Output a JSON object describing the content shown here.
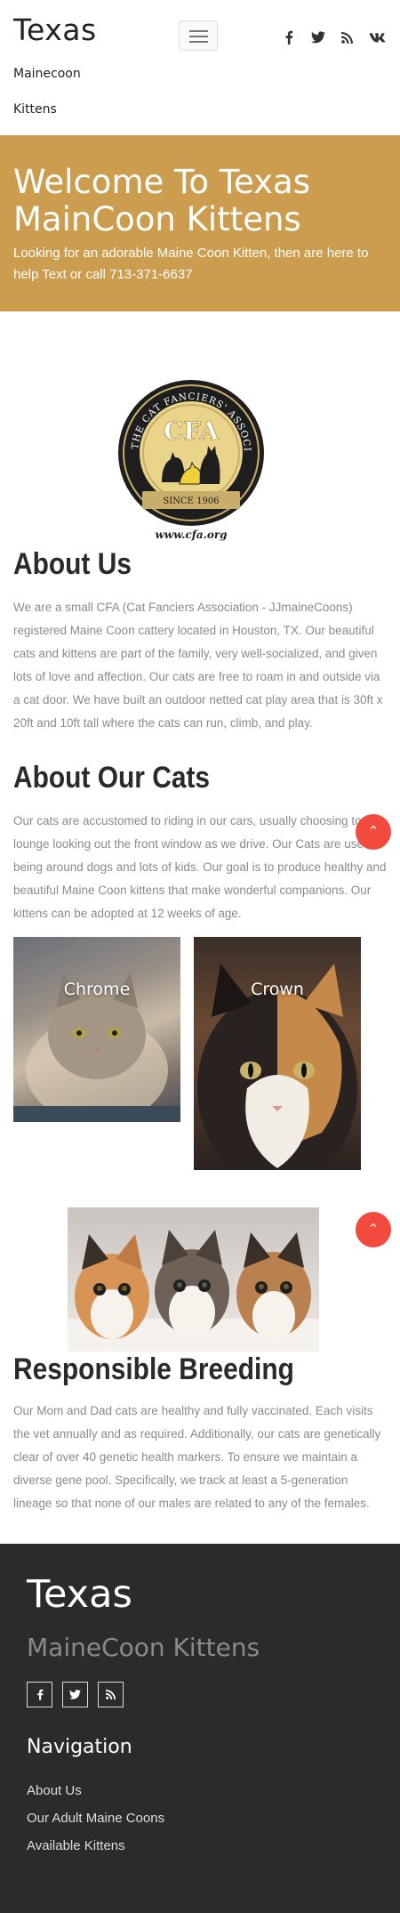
{
  "header": {
    "brand": "Texas",
    "nav": [
      "Mainecoon",
      "Kittens"
    ],
    "social_icons": [
      "facebook-icon",
      "twitter-icon",
      "rss-icon",
      "vk-icon"
    ]
  },
  "hero": {
    "title": "Welcome To Texas MainCoon Kittens",
    "subtitle": "Looking for an adorable Maine Coon Kitten, then are here to help Text or call 713-371-6637",
    "background_color": "#cc9d4e"
  },
  "cfa_logo": {
    "initials": "CFA",
    "ring_text": "THE CAT FANCIERS' ASSOCIATION",
    "since": "SINCE 1906",
    "url": "www.cfa.org"
  },
  "about_us": {
    "heading": "About Us",
    "body": "We are a small CFA (Cat Fanciers Association - JJmaineCoons) registered Maine Coon cattery located in Houston, TX. Our beautiful cats and kittens are part of the family, very well-socialized, and given lots of love and affection. Our cats are free to roam in and outside via a cat door. We have built an outdoor netted cat play area that is 30ft x 20ft and 10ft tall where the cats can run, climb, and play."
  },
  "about_cats": {
    "heading": "About Our Cats",
    "body": "Our cats are accustomed to riding in our cars, usually choosing to lounge looking out the front window as we drive. Our Cats are used to being around dogs and lots of kids. Our goal is to produce healthy and beautiful Maine Coon kittens that make wonderful companions. Our kittens can be adopted at 12 weeks of age.",
    "cats": [
      {
        "name": "Chrome"
      },
      {
        "name": "Crown"
      }
    ]
  },
  "breeding": {
    "heading": "Responsible Breeding",
    "body": "Our Mom and Dad cats are healthy and fully vaccinated. Each visits the vet annually and as required. Additionally, our cats are genetically clear of over 40 genetic health markers. To ensure we maintain a diverse gene pool. Specifically, we track at least a 5-generation lineage so that none of our males are related to any of the females."
  },
  "footer": {
    "title": "Texas",
    "subtitle": "MaineCoon Kittens",
    "social_icons": [
      "facebook-icon",
      "twitter-icon",
      "rss-icon"
    ],
    "nav_heading": "Navigation",
    "links": [
      "About Us",
      "Our Adult Maine Coons",
      "Available Kittens"
    ]
  },
  "colors": {
    "accent": "#cc9d4e",
    "fab": "#f24a3d",
    "footer_bg": "#2b2b2b"
  }
}
